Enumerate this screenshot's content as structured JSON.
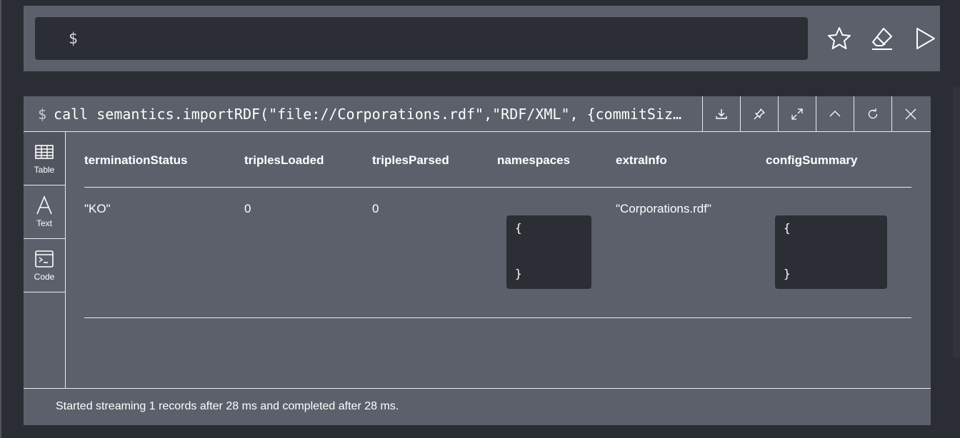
{
  "editor": {
    "prompt": "$",
    "actions": [
      {
        "icon": "star-icon",
        "name": "favorite-button"
      },
      {
        "icon": "eraser-icon",
        "name": "clear-editor-button"
      },
      {
        "icon": "play-icon",
        "name": "run-query-button"
      }
    ]
  },
  "frame": {
    "prompt": "$",
    "query": "call semantics.importRDF(\"file://Corporations.rdf\",\"RDF/XML\", {commitSiz…",
    "buttons": [
      {
        "icon": "download-icon",
        "name": "export-button"
      },
      {
        "icon": "pin-icon",
        "name": "pin-button"
      },
      {
        "icon": "expand-icon",
        "name": "fullscreen-button"
      },
      {
        "icon": "chevron-up-icon",
        "name": "collapse-button"
      },
      {
        "icon": "rerun-icon",
        "name": "rerun-button"
      },
      {
        "icon": "close-icon",
        "name": "close-button"
      }
    ],
    "view_tabs": [
      {
        "label": "Table",
        "icon": "table-icon",
        "active": true
      },
      {
        "label": "Text",
        "icon": "text-icon",
        "active": false
      },
      {
        "label": "Code",
        "icon": "code-icon",
        "active": false
      }
    ],
    "table": {
      "columns": [
        "terminationStatus",
        "triplesLoaded",
        "triplesParsed",
        "namespaces",
        "extraInfo",
        "configSummary"
      ],
      "rows": [
        {
          "terminationStatus": "\"KO\"",
          "triplesLoaded": "0",
          "triplesParsed": "0",
          "namespaces": {
            "open": "{",
            "close": "}"
          },
          "extraInfo": "\"Corporations.rdf\"",
          "configSummary": {
            "open": "{",
            "close": "}"
          }
        }
      ]
    },
    "status": "Started streaming 1 records after 28 ms and completed after 28 ms."
  },
  "colors": {
    "background": "#2a2e34",
    "panel": "#5b606b",
    "editor_input": "#2b2f35",
    "divider": "#eaeaea"
  }
}
